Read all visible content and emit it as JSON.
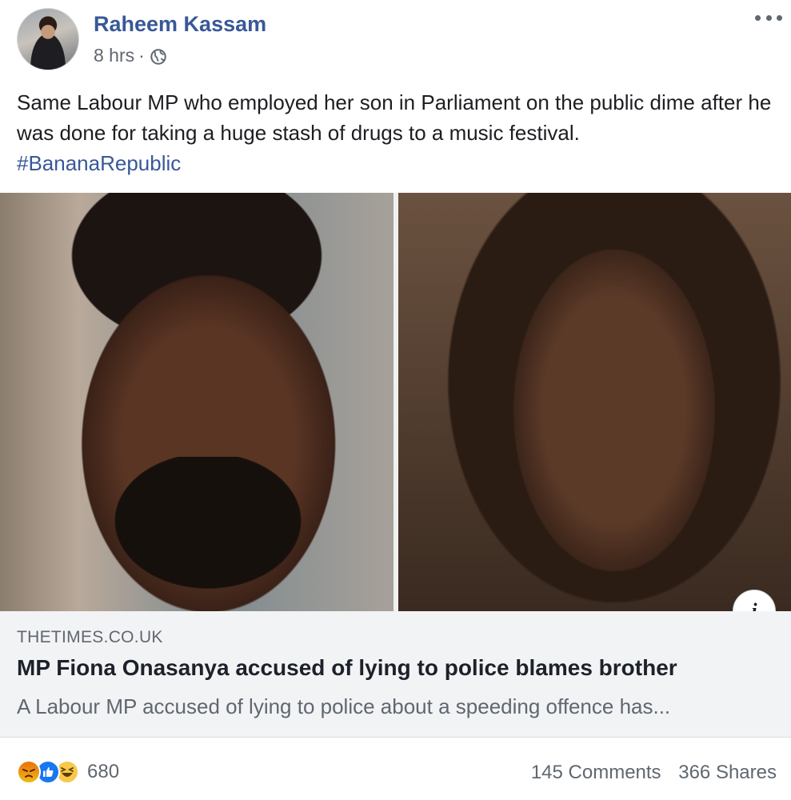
{
  "post": {
    "author": "Raheem Kassam",
    "time": "8 hrs",
    "separator": "·",
    "text": "Same Labour MP who employed her son in Parliament on the public dime after he was done for taking a huge stash of drugs to a music festival.",
    "hashtag": "#BananaRepublic"
  },
  "link": {
    "domain": "THETIMES.CO.UK",
    "title": "MP Fiona Onasanya accused of lying to police blames brother",
    "description": "A Labour MP accused of lying to police about a speeding offence has...",
    "info_label": "i"
  },
  "footer": {
    "reaction_icons": [
      "angry-icon",
      "like-icon",
      "haha-icon"
    ],
    "reaction_count": "680",
    "comments": "145 Comments",
    "shares": "366 Shares"
  },
  "colors": {
    "author": "#385898",
    "hashtag": "#385898",
    "like": "#1877f2"
  }
}
